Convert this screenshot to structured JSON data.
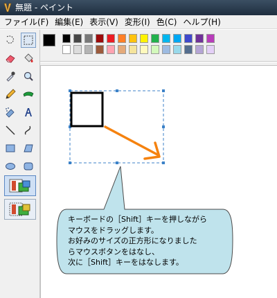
{
  "window": {
    "title": "無題 - ペイント"
  },
  "menu": [
    "ファイル(F)",
    "編集(E)",
    "表示(V)",
    "変形(I)",
    "色(C)",
    "ヘルプ(H)"
  ],
  "tools": [
    {
      "name": "free-select-icon"
    },
    {
      "name": "rect-select-icon"
    },
    {
      "name": "eraser-icon"
    },
    {
      "name": "fill-bucket-icon"
    },
    {
      "name": "eyedropper-icon"
    },
    {
      "name": "magnifier-icon"
    },
    {
      "name": "pencil-icon"
    },
    {
      "name": "brush-icon"
    },
    {
      "name": "airbrush-icon"
    },
    {
      "name": "text-icon"
    },
    {
      "name": "line-icon"
    },
    {
      "name": "curve-icon"
    },
    {
      "name": "rectangle-icon"
    },
    {
      "name": "polygon-icon"
    },
    {
      "name": "ellipse-icon"
    },
    {
      "name": "rounded-rect-icon"
    }
  ],
  "palette": {
    "foreground": "#000000",
    "background": "#ffffff",
    "row1": [
      "#000000",
      "#808080",
      "#800000",
      "#808000",
      "#008000",
      "#008080",
      "#000080",
      "#800080",
      "#808040",
      "#004040",
      "#0080ff",
      "#004080",
      "#8000ff",
      "#804000"
    ],
    "row1_display": [
      "#000000",
      "#464646",
      "#787878",
      "#9c0a0a",
      "#ec1c24",
      "#ff7f27",
      "#ffc20e",
      "#fff200",
      "#22b14c",
      "#00b7ef",
      "#00a8f3",
      "#3f48cc",
      "#6f3198",
      "#b83dba"
    ],
    "row2_display": [
      "#ffffff",
      "#dcdcdc",
      "#b4b4b4",
      "#9c5a3c",
      "#ffa3b1",
      "#e5aa7a",
      "#f5e49c",
      "#fff9bd",
      "#d3f9bc",
      "#9dbbe1",
      "#99d9ea",
      "#546d8e",
      "#b5a5d5",
      "#e4d0f7"
    ]
  },
  "callout": {
    "lines": [
      "キーボードの［Shift］キーを押しながら",
      "マウスをドラッグします。",
      "お好みのサイズの正方形になりました",
      "らマウスボタンをはなし、",
      "次に［Shift］キーをはなします。"
    ]
  },
  "colors": {
    "accent_arrow": "#f5820f",
    "callout_fill": "#bfe3ec",
    "selection": "#3c82c8"
  }
}
